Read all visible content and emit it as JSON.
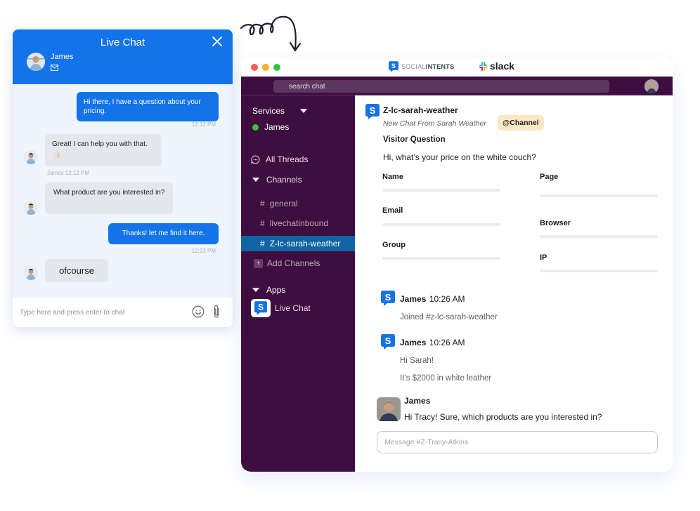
{
  "widget": {
    "title": "Live Chat",
    "agent_name": "James",
    "icons": {
      "close": "close-icon",
      "mail": "mail-icon",
      "emoji": "smiley-icon",
      "attach": "paperclip-icon"
    },
    "colors": {
      "header": "#1373e8",
      "background": "#eef5fe",
      "incoming_bubble": "#e4e7ec"
    },
    "messages": [
      {
        "direction": "out",
        "text": "Hi there, I have a question about your pricing.",
        "meta": "12:12 PM"
      },
      {
        "direction": "in",
        "text": "Great! I can help you with that.",
        "emoji": "👍🏻",
        "meta": "James 12:12 PM"
      },
      {
        "direction": "in",
        "text": "What product are you interested in?",
        "meta": ""
      },
      {
        "direction": "out",
        "text": "Thanks! let me find it here.",
        "meta": "12:13 PM"
      },
      {
        "direction": "in",
        "text": "ofcourse",
        "meta": ""
      }
    ],
    "input_placeholder": "Type here and press enter to chat"
  },
  "slack": {
    "brand_social_light": "SOCIAL",
    "brand_social_bold": "INTENTS",
    "brand_slack": "slack",
    "search_placeholder": "search chat",
    "colors": {
      "sidebar": "#3f0e40",
      "active_channel": "#1164a3",
      "presence": "#2bac76",
      "channel_badge": "#fbe7c3"
    },
    "sidebar": {
      "services_label": "Services",
      "user": "James",
      "all_threads": "All Threads",
      "channels_label": "Channels",
      "channels": [
        {
          "name": "general",
          "active": false
        },
        {
          "name": "livechatinbound",
          "active": false
        },
        {
          "name": "Z-lc-sarah-weather",
          "active": true
        }
      ],
      "channel_prefix": "#",
      "add_channels": "Add Channels",
      "apps_label": "Apps",
      "apps": [
        {
          "name": "Live Chat"
        }
      ]
    },
    "main": {
      "channel_title": "Z-lc-sarah-weather",
      "subtitle": "New Chat From Sarah Weather",
      "badge": "@Channel",
      "question_label": "Visitor Question",
      "question_text": "Hi, what’s your price on the white couch?",
      "fields_left": [
        "Name",
        "Email",
        "Group"
      ],
      "fields_right": [
        "Page",
        "Browser",
        "IP"
      ],
      "messages": [
        {
          "author": "James",
          "time": "10:26 AM",
          "lines": [
            "Joined #z-lc-sarah-weather"
          ]
        },
        {
          "author": "James",
          "time": "10:26 AM",
          "lines": [
            "Hi Sarah!",
            "It’s $2000 in white leather"
          ]
        },
        {
          "author": "James",
          "time": "",
          "lines": [
            "Hi Tracy! Sure, which products are you interested in?"
          ]
        }
      ],
      "compose_placeholder": "Message #Z-Tracy-Atkins"
    }
  }
}
